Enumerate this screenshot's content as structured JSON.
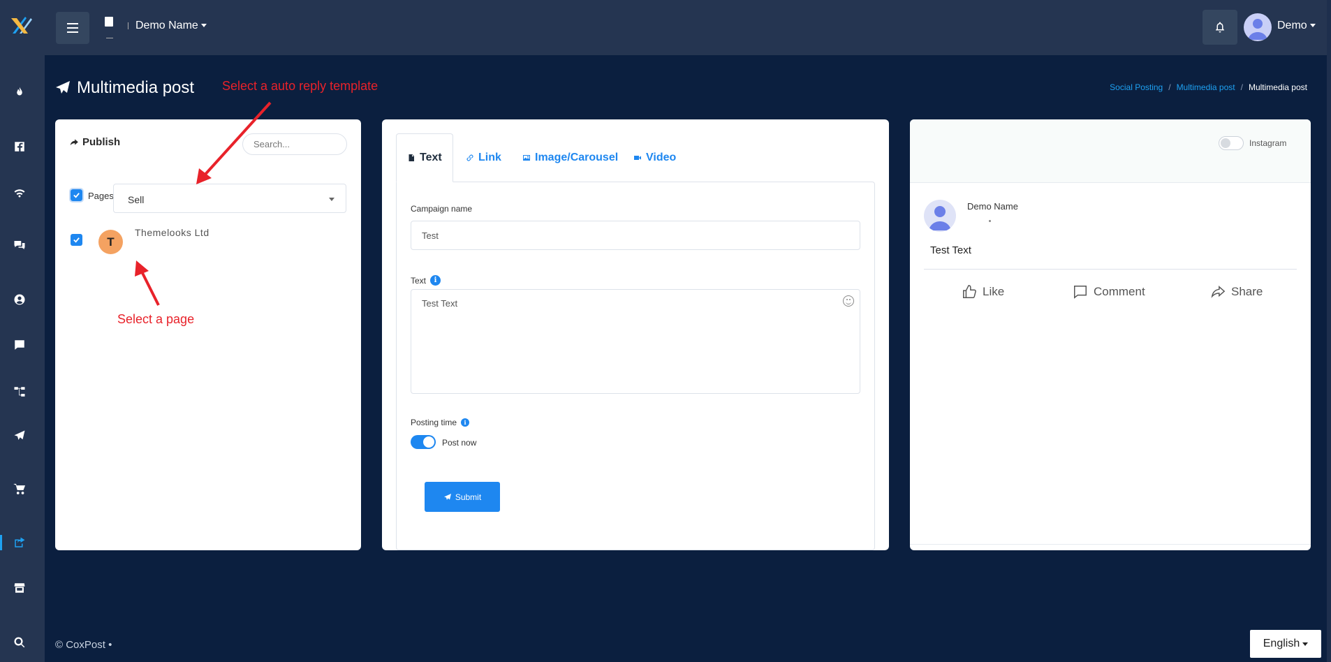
{
  "topbar": {
    "brand_name": "Demo Name",
    "user_name": "Demo"
  },
  "page": {
    "title": "Multimedia post",
    "breadcrumb": [
      "Social Posting",
      "Multimedia post",
      "Multimedia post"
    ]
  },
  "annotations": {
    "template_hint": "Select a auto reply template",
    "page_hint": "Select a page"
  },
  "left_card": {
    "publish_label": "Publish",
    "search_placeholder": "Search...",
    "pages_label": "Pages",
    "template_value": "Sell",
    "page": {
      "initial": "T",
      "name": "Themelooks Ltd"
    }
  },
  "mid_card": {
    "tabs": [
      {
        "label": "Text"
      },
      {
        "label": "Link"
      },
      {
        "label": "Image/Carousel"
      },
      {
        "label": "Video"
      }
    ],
    "campaign_label": "Campaign name",
    "campaign_value": "Test",
    "text_label": "Text",
    "text_value": "Test Text",
    "posting_time_label": "Posting time",
    "post_now_label": "Post now",
    "submit_label": "Submit"
  },
  "right_card": {
    "instagram_label": "Instagram",
    "preview_name": "Demo Name",
    "preview_text": "Test Text",
    "actions": [
      {
        "label": "Like"
      },
      {
        "label": "Comment"
      },
      {
        "label": "Share"
      }
    ]
  },
  "footer": {
    "copyright": "© CoxPost •",
    "language": "English"
  },
  "colors": {
    "accent": "#1e87f0",
    "sidebar": "#253551",
    "background": "#0b1f3f",
    "annotation": "#e8222a"
  }
}
